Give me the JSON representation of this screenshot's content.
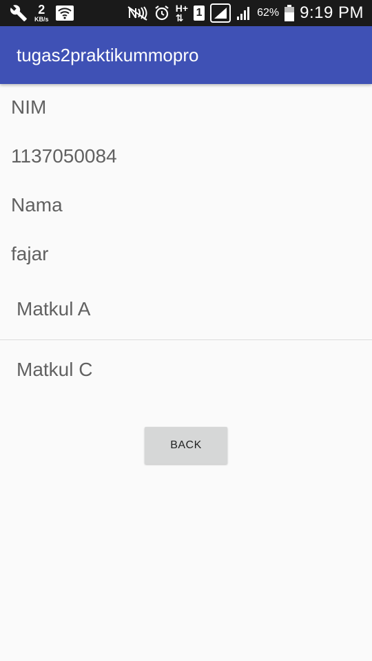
{
  "status_bar": {
    "speed_value": "2",
    "speed_unit": "KB/s",
    "network_type": "H+",
    "sim_slot": "1",
    "battery_percent": "62%",
    "time": "9:19 PM",
    "icons": [
      "wrench-icon",
      "wifi-icon",
      "nfc-icon",
      "alarm-icon",
      "signal-icon",
      "battery-icon"
    ]
  },
  "app_bar": {
    "title": "tugas2praktikummopro",
    "color": "#3f51b5"
  },
  "content": {
    "nim_label": "NIM",
    "nim_value": "1137050084",
    "nama_label": "Nama",
    "nama_value": "fajar",
    "matkul_items": [
      "Matkul A",
      "Matkul C"
    ]
  },
  "actions": {
    "back_label": "BACK"
  }
}
